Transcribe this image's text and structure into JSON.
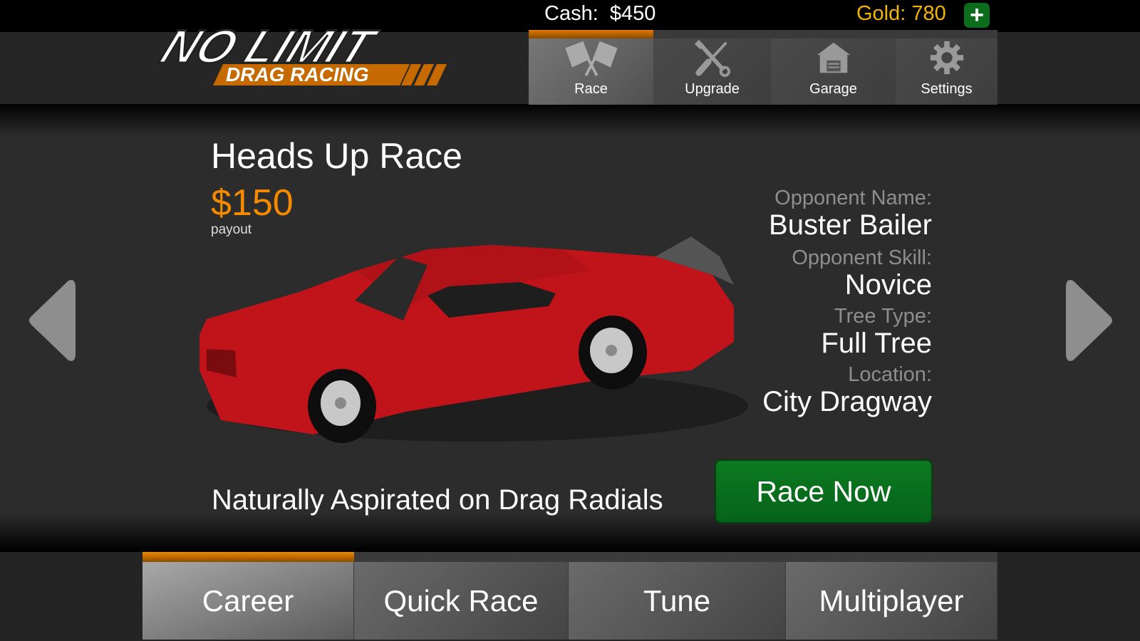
{
  "app": {
    "logo_text_top": "NO LIMIT",
    "logo_text_bottom": "DRAG RACING"
  },
  "status": {
    "cash_label": "Cash:",
    "cash_value": "$450",
    "gold_label": "Gold:",
    "gold_value": "780",
    "add_gold_icon": "plus-icon",
    "add_gold_glyph": "+"
  },
  "nav": {
    "active_index": 0,
    "items": [
      {
        "label": "Race",
        "icon": "checkered-flags-icon"
      },
      {
        "label": "Upgrade",
        "icon": "wrench-screwdriver-icon"
      },
      {
        "label": "Garage",
        "icon": "garage-icon"
      },
      {
        "label": "Settings",
        "icon": "gear-icon"
      }
    ]
  },
  "race": {
    "title": "Heads Up Race",
    "payout": "$150",
    "payout_label": "payout",
    "description": "Naturally Aspirated on Drag Radials",
    "details": [
      {
        "label": "Opponent Name:",
        "value": "Buster Bailer"
      },
      {
        "label": "Opponent Skill:",
        "value": "Novice"
      },
      {
        "label": "Tree Type:",
        "value": "Full Tree"
      },
      {
        "label": "Location:",
        "value": "City Dragway"
      }
    ],
    "race_now_label": "Race Now",
    "car_color": "#c0141a"
  },
  "arrows": {
    "prev_icon": "arrow-left-icon",
    "next_icon": "arrow-right-icon"
  },
  "tabs": {
    "active_index": 0,
    "items": [
      {
        "label": "Career"
      },
      {
        "label": "Quick Race"
      },
      {
        "label": "Tune"
      },
      {
        "label": "Multiplayer"
      }
    ]
  },
  "colors": {
    "accent_orange": "#f48a00",
    "gold_text": "#f2b500",
    "race_now_green": "#0b7a1f"
  }
}
